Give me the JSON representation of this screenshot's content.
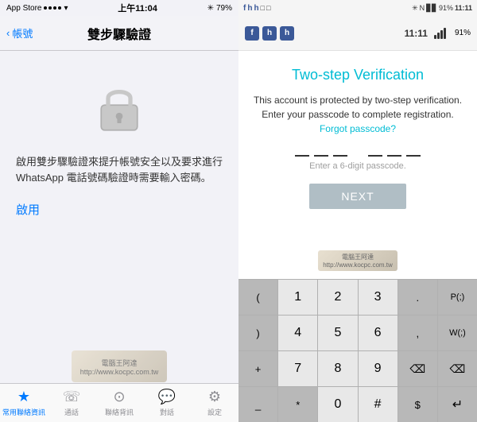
{
  "left": {
    "statusBar": {
      "appName": "App Store",
      "dots": 4,
      "wifi": "WiFi",
      "time": "上午11:04",
      "bluetooth": "BT",
      "battery": "79%"
    },
    "navBar": {
      "backLabel": "帳號",
      "title": "雙步驟驗證"
    },
    "content": {
      "description": "啟用雙步驟驗證來提升帳號安全以及要求進行 WhatsApp 電話號碼驗證時需要輸入密碼。",
      "enableLabel": "啟用"
    },
    "tabBar": {
      "tabs": [
        {
          "label": "常用聯絡資訊",
          "icon": "★"
        },
        {
          "label": "通話",
          "icon": "📞"
        },
        {
          "label": "聯絡背訊",
          "icon": "👤"
        },
        {
          "label": "對話",
          "icon": "💬"
        },
        {
          "label": "設定",
          "icon": "⚙"
        }
      ]
    }
  },
  "right": {
    "statusBar": {
      "time": "11:11",
      "battery": "91%"
    },
    "topBar": {
      "fbIcons": [
        "f",
        "h",
        "h",
        "□",
        "□"
      ],
      "bluetooth": "BT",
      "signal": "4G",
      "battery": "91%",
      "time": "11:11"
    },
    "content": {
      "title": "Two-step Verification",
      "description": "This account is protected by two-step verification.\nEnter your passcode to complete registration.",
      "forgotLabel": "Forgot\npasscode?",
      "passcodeHint": "Enter a 6-digit passcode.",
      "nextButton": "NEXT"
    },
    "keyboard": {
      "rows": [
        [
          {
            "label": "(",
            "type": "dark"
          },
          {
            "label": "1",
            "type": "light"
          },
          {
            "label": "2",
            "type": "light"
          },
          {
            "label": "3",
            "type": "light"
          },
          {
            "label": ".",
            "type": "dark"
          },
          {
            "label": "P(;)",
            "type": "dark"
          }
        ],
        [
          {
            "label": ")",
            "type": "dark"
          },
          {
            "label": "4",
            "type": "light"
          },
          {
            "label": "5",
            "type": "light"
          },
          {
            "label": "6",
            "type": "light"
          },
          {
            "label": ",",
            "type": "dark"
          },
          {
            "label": "W(;)",
            "type": "dark"
          }
        ],
        [
          {
            "label": "+",
            "type": "dark"
          },
          {
            "label": "7",
            "type": "light"
          },
          {
            "label": "8",
            "type": "light"
          },
          {
            "label": "9",
            "type": "light"
          },
          {
            "label": "←",
            "type": "dark",
            "action": "backspace"
          },
          {
            "label": "←",
            "type": "dark",
            "action": "backspace2"
          }
        ],
        [
          {
            "label": "_",
            "type": "dark"
          },
          {
            "label": "*",
            "type": "dark"
          },
          {
            "label": "0",
            "type": "light"
          },
          {
            "label": "#",
            "type": "light"
          },
          {
            "label": "$",
            "type": "dark"
          },
          {
            "label": "↵",
            "type": "dark",
            "action": "enter"
          }
        ]
      ]
    }
  }
}
